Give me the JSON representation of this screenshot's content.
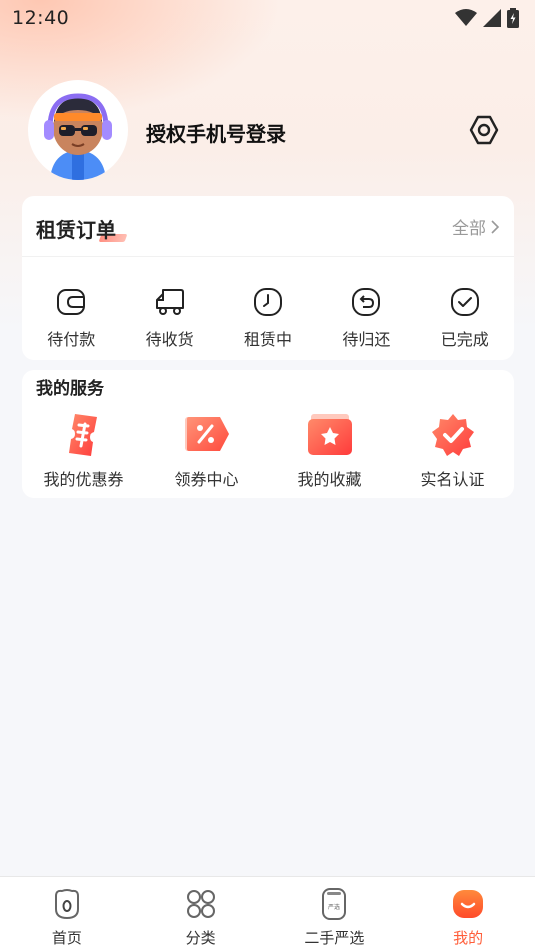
{
  "status_bar": {
    "time": "12:40"
  },
  "profile": {
    "login_text": "授权手机号登录"
  },
  "orders": {
    "title": "租赁订单",
    "all_link": "全部",
    "items": [
      {
        "label": "待付款",
        "icon": "wallet-icon"
      },
      {
        "label": "待收货",
        "icon": "truck-icon"
      },
      {
        "label": "租赁中",
        "icon": "clock-icon"
      },
      {
        "label": "待归还",
        "icon": "return-icon"
      },
      {
        "label": "已完成",
        "icon": "check-circle-icon"
      }
    ]
  },
  "services": {
    "title": "我的服务",
    "items": [
      {
        "label": "我的优惠券",
        "icon": "coupon-icon"
      },
      {
        "label": "领券中心",
        "icon": "discount-tag-icon"
      },
      {
        "label": "我的收藏",
        "icon": "favorite-star-icon"
      },
      {
        "label": "实名认证",
        "icon": "verified-badge-icon"
      }
    ]
  },
  "tabbar": {
    "tabs": [
      {
        "label": "首页",
        "active": false
      },
      {
        "label": "分类",
        "active": false
      },
      {
        "label": "二手严选",
        "active": false
      },
      {
        "label": "我的",
        "active": true
      }
    ],
    "secondhand_icon_text": "严选"
  },
  "colors": {
    "accent": "#ff5e3a",
    "background": "#f6f7fa",
    "card": "#ffffff"
  }
}
